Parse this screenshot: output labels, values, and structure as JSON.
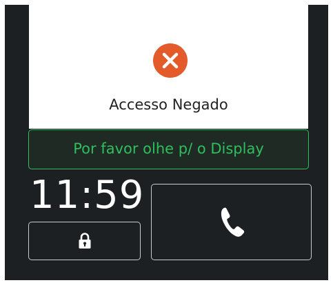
{
  "status": {
    "icon": "error-x-icon",
    "icon_color": "#e35a2b",
    "message": "Accesso Negado"
  },
  "banner": {
    "text": "Por favor olhe p/ o Display",
    "color": "#2fbf5c"
  },
  "clock": {
    "time": "11:59"
  },
  "buttons": {
    "unlock_icon": "lock-icon",
    "call_icon": "phone-icon"
  }
}
